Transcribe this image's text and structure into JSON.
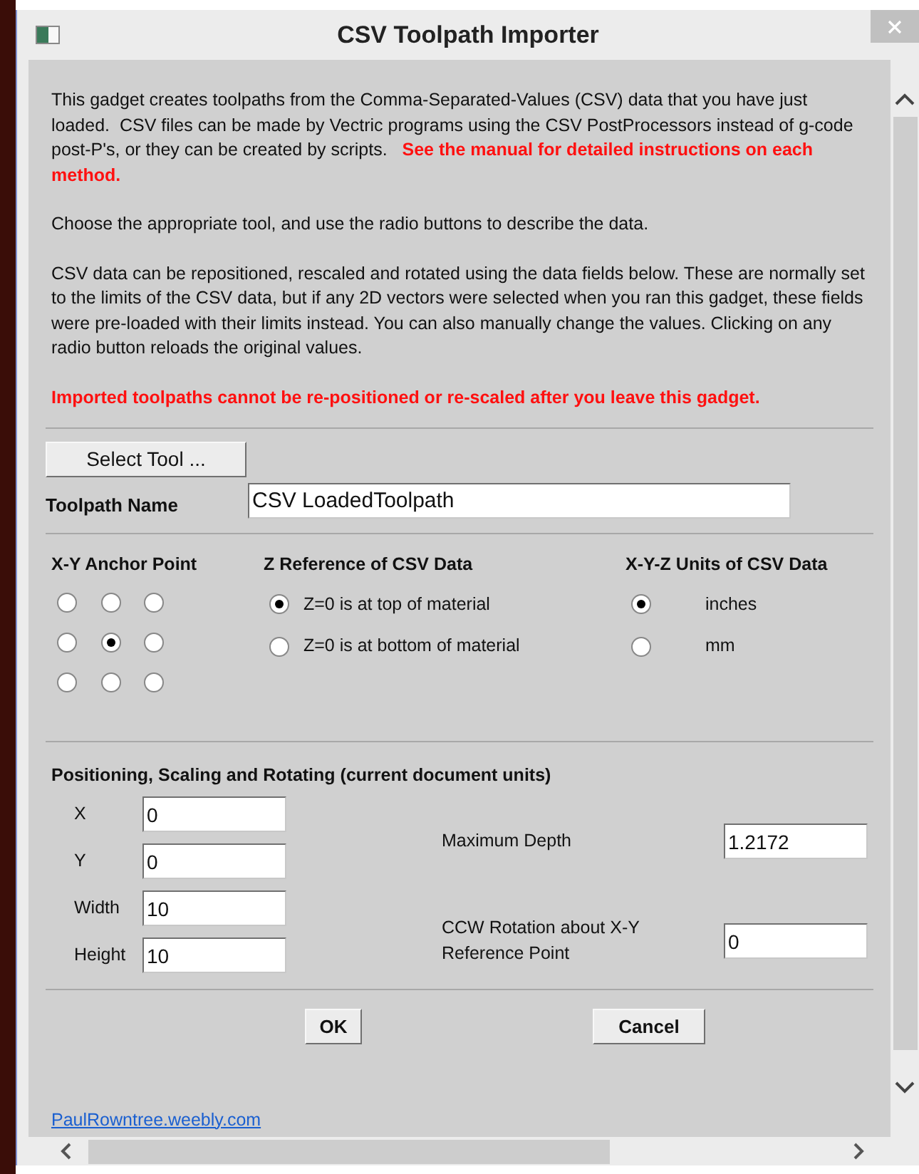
{
  "window": {
    "title": "CSV Toolpath Importer"
  },
  "intro": [
    {
      "kind": "normal",
      "text": "This gadget creates toolpaths from the Comma-Separated-Values (CSV) data that you have just loaded.  CSV files can be made by Vectric programs using the CSV PostProcessors instead of g-code post-P's, or they can be created by scripts.   "
    },
    {
      "kind": "warning",
      "text": "See the manual for detailed instructions on each method."
    }
  ],
  "paragraphs": [
    {
      "kind": "normal",
      "text": "Choose the appropriate tool, and use the radio buttons to describe the data."
    },
    {
      "kind": "normal",
      "text": "CSV data can be repositioned, rescaled and rotated using the data fields below.  These are normally set to the limits of the CSV data, but if any 2D vectors were selected when you ran this gadget, these fields were pre-loaded with their limits instead.  You can also manually change the values.  Clicking on any radio button reloads the original values."
    },
    {
      "kind": "warning",
      "text": "Imported toolpaths cannot be re-positioned or re-scaled after you leave this gadget."
    }
  ],
  "select_tool_button": "Select Tool ...",
  "toolpath_name": {
    "label": "Toolpath Name",
    "value": "CSV LoadedToolpath"
  },
  "anchor": {
    "heading": "X-Y Anchor Point",
    "points": [
      {
        "selected": false
      },
      {
        "selected": false
      },
      {
        "selected": false
      },
      {
        "selected": false
      },
      {
        "selected": true
      },
      {
        "selected": false
      },
      {
        "selected": false
      },
      {
        "selected": false
      },
      {
        "selected": false
      }
    ]
  },
  "z_reference": {
    "heading": "Z Reference of CSV Data",
    "options": [
      {
        "label": "Z=0 is at top of material",
        "selected": true
      },
      {
        "label": "Z=0 is at bottom of material",
        "selected": false
      }
    ]
  },
  "units": {
    "heading": "X-Y-Z Units of CSV Data",
    "options": [
      {
        "label": "inches",
        "selected": true
      },
      {
        "label": "mm",
        "selected": false
      }
    ]
  },
  "positioning": {
    "heading": "Positioning, Scaling and Rotating (current document units)",
    "fields": [
      {
        "label": "X",
        "value": "0"
      },
      {
        "label": "Y",
        "value": "0"
      },
      {
        "label": "Width",
        "value": "10"
      },
      {
        "label": "Height",
        "value": "10"
      }
    ],
    "maximum_depth": {
      "label": "Maximum Depth",
      "value": "1.2172"
    },
    "rotation": {
      "label": "CCW Rotation about X-Y Reference Point",
      "value": "0"
    }
  },
  "buttons": [
    "OK",
    "Cancel"
  ],
  "link": "PaulRowntree.weebly.com"
}
